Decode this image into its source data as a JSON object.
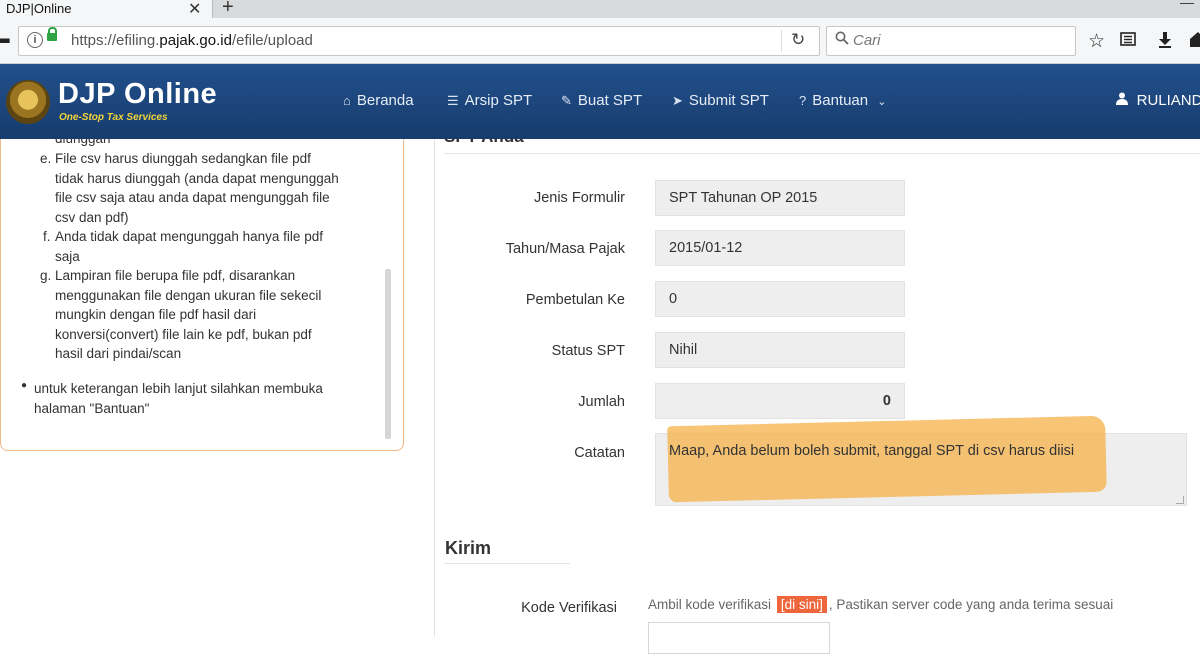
{
  "browser": {
    "tab_title": "DJP|Online",
    "tab_close": "✕",
    "new_tab": "+",
    "back": "⬅",
    "url_plain": "https://efiling.",
    "url_domain": "pajak.go.id",
    "url_path": "/efile/upload",
    "reload": "↻",
    "search_placeholder": "Cari",
    "toolbar_icons": [
      "star-icon",
      "reader-icon",
      "download-icon",
      "home-icon"
    ]
  },
  "site": {
    "brand": "DJP Online",
    "tagline": "One-Stop Tax Services",
    "nav": [
      {
        "label": "Beranda",
        "icon": "home-icon"
      },
      {
        "label": "Arsip SPT",
        "icon": "list-icon"
      },
      {
        "label": "Buat SPT",
        "icon": "edit-icon"
      },
      {
        "label": "Submit SPT",
        "icon": "send-icon"
      },
      {
        "label": "Bantuan",
        "icon": "help-icon"
      }
    ],
    "user": "RULIANDA"
  },
  "info": {
    "cut_line": "diunggah",
    "items": [
      {
        "marker": "e.",
        "lines": [
          "File csv harus diunggah sedangkan file pdf",
          "tidak harus diunggah (anda dapat mengunggah",
          "file csv saja atau anda dapat mengunggah file",
          "csv dan pdf)"
        ]
      },
      {
        "marker": "f.",
        "lines": [
          "Anda tidak dapat mengunggah hanya file pdf",
          "saja"
        ]
      },
      {
        "marker": "g.",
        "lines": [
          "Lampiran file berupa file pdf, disarankan",
          "menggunakan file dengan ukuran file sekecil",
          "mungkin dengan file pdf hasil dari",
          "konversi(convert) file lain ke pdf, bukan pdf",
          "hasil dari pindai/scan"
        ]
      }
    ],
    "bullet": [
      "untuk keterangan lebih lanjut silahkan membuka",
      "halaman \"Bantuan\""
    ]
  },
  "form": {
    "section_title": "SPT Anda",
    "fields": [
      {
        "label": "Jenis Formulir",
        "value": "SPT Tahunan OP 2015"
      },
      {
        "label": "Tahun/Masa Pajak",
        "value": "2015/01-12"
      },
      {
        "label": "Pembetulan Ke",
        "value": "0"
      },
      {
        "label": "Status SPT",
        "value": "Nihil"
      },
      {
        "label": "Jumlah",
        "value": "0"
      }
    ],
    "catatan_label": "Catatan",
    "catatan_value": "Maap, Anda belum boleh submit, tanggal SPT di csv harus diisi",
    "highlight_color": "#f6b450"
  },
  "kirim": {
    "title": "Kirim",
    "kode_label": "Kode Verifikasi",
    "text_before": "Ambil kode verifikasi",
    "link": "[di sini]",
    "text_after": ", Pastikan server code yang anda terima sesuai",
    "link_color": "#f0663c"
  }
}
